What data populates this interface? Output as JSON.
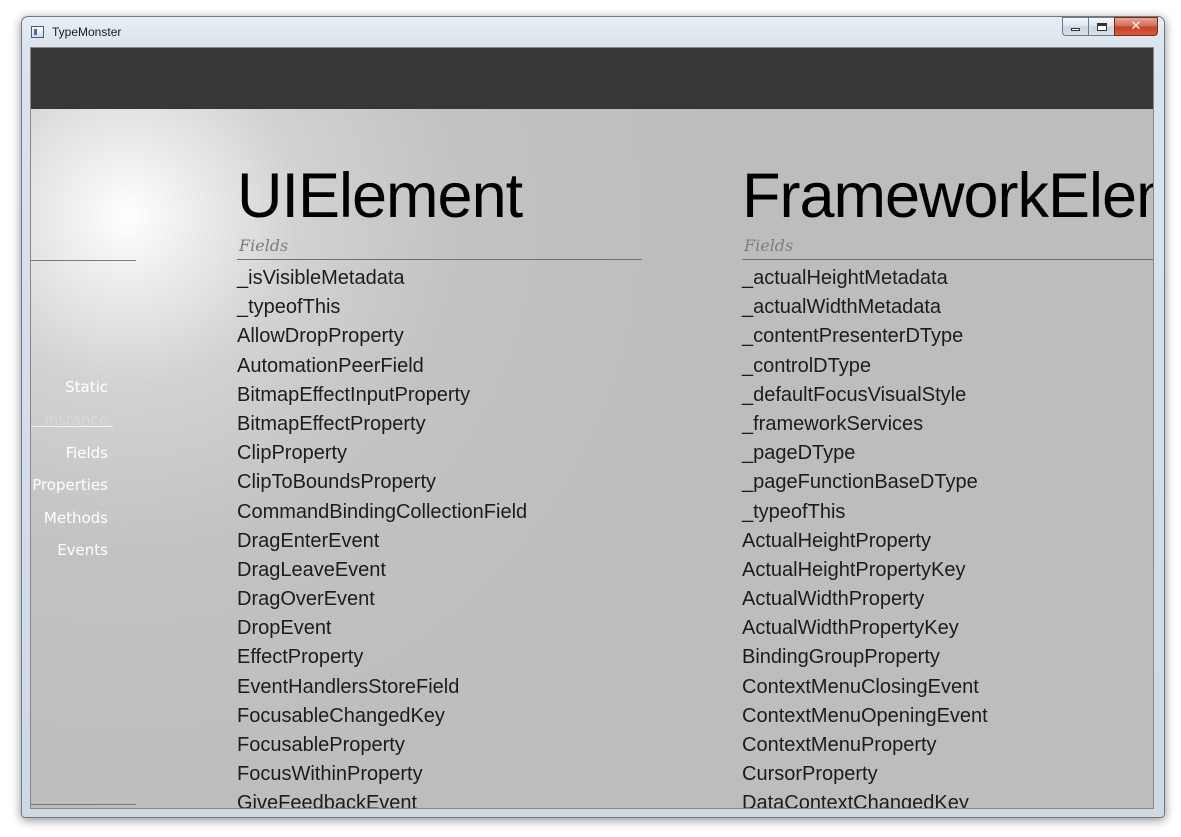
{
  "window": {
    "title": "TypeMonster"
  },
  "caption_buttons": {
    "close_glyph": "✕"
  },
  "sidebar": {
    "items": [
      {
        "label": "Static",
        "active": true
      },
      {
        "label": "Instance",
        "active": false
      },
      {
        "label": "Fields",
        "active": true
      },
      {
        "label": "Properties",
        "active": true
      },
      {
        "label": "Methods",
        "active": true
      },
      {
        "label": "Events",
        "active": true
      }
    ]
  },
  "columns": [
    {
      "type_name": "UIElement",
      "section": "Fields",
      "items": [
        "_isVisibleMetadata",
        "_typeofThis",
        "AllowDropProperty",
        "AutomationPeerField",
        "BitmapEffectInputProperty",
        "BitmapEffectProperty",
        "ClipProperty",
        "ClipToBoundsProperty",
        "CommandBindingCollectionField",
        "DragEnterEvent",
        "DragLeaveEvent",
        "DragOverEvent",
        "DropEvent",
        "EffectProperty",
        "EventHandlersStoreField",
        "FocusableChangedKey",
        "FocusableProperty",
        "FocusWithinProperty",
        "GiveFeedbackEvent"
      ]
    },
    {
      "type_name": "FrameworkElement",
      "section": "Fields",
      "items": [
        "_actualHeightMetadata",
        "_actualWidthMetadata",
        "_contentPresenterDType",
        "_controlDType",
        "_defaultFocusVisualStyle",
        "_frameworkServices",
        "_pageDType",
        "_pageFunctionBaseDType",
        "_typeofThis",
        "ActualHeightProperty",
        "ActualHeightPropertyKey",
        "ActualWidthProperty",
        "ActualWidthPropertyKey",
        "BindingGroupProperty",
        "ContextMenuClosingEvent",
        "ContextMenuOpeningEvent",
        "ContextMenuProperty",
        "CursorProperty",
        "DataContextChangedKey"
      ]
    }
  ]
}
